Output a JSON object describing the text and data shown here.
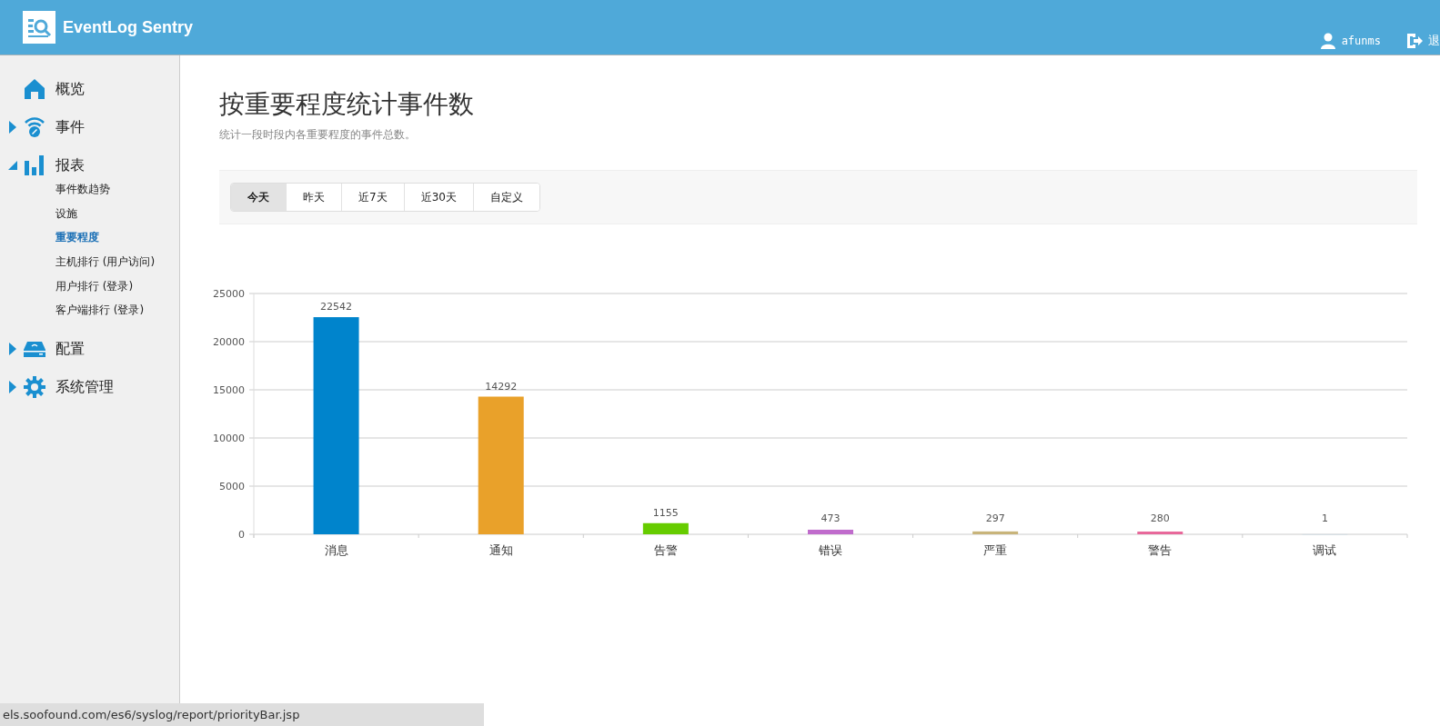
{
  "header": {
    "app_name": "EventLog Sentry",
    "user": "afunms",
    "logout": "退"
  },
  "sidebar": {
    "items": [
      {
        "label": "概览",
        "kind": "link"
      },
      {
        "label": "事件",
        "kind": "group",
        "expanded": false
      },
      {
        "label": "报表",
        "kind": "group",
        "expanded": true,
        "children": [
          {
            "label": "事件数趋势",
            "selected": false
          },
          {
            "label": "设施",
            "selected": false
          },
          {
            "label": "重要程度",
            "selected": true
          },
          {
            "label": "主机排行 (用户访问)",
            "selected": false
          },
          {
            "label": "用户排行 (登录)",
            "selected": false
          },
          {
            "label": "客户端排行 (登录)",
            "selected": false
          }
        ]
      },
      {
        "label": "配置",
        "kind": "group",
        "expanded": false
      },
      {
        "label": "系统管理",
        "kind": "group",
        "expanded": false
      }
    ]
  },
  "page": {
    "title": "按重要程度统计事件数",
    "subtitle": "统计一段时段内各重要程度的事件总数。"
  },
  "range_tabs": [
    {
      "label": "今天",
      "selected": true
    },
    {
      "label": "昨天",
      "selected": false
    },
    {
      "label": "近7天",
      "selected": false
    },
    {
      "label": "近30天",
      "selected": false
    },
    {
      "label": "自定义",
      "selected": false
    }
  ],
  "chart": {
    "chart_data": {
      "type": "bar",
      "categories": [
        "消息",
        "通知",
        "告警",
        "错误",
        "严重",
        "警告",
        "调试"
      ],
      "values": [
        22542,
        14292,
        1155,
        473,
        297,
        280,
        1
      ],
      "colors": [
        "#0084cc",
        "#e9a12a",
        "#66cc00",
        "#c06ccc",
        "#c8b47a",
        "#e8679a",
        "#4fa9d9"
      ],
      "ylim": [
        0,
        25000
      ],
      "yticks": [
        0,
        5000,
        10000,
        15000,
        20000,
        25000
      ],
      "grid": true,
      "data_labels": true
    }
  },
  "status_bar": {
    "url": "els.soofound.com/es6/syslog/report/priorityBar.jsp"
  }
}
